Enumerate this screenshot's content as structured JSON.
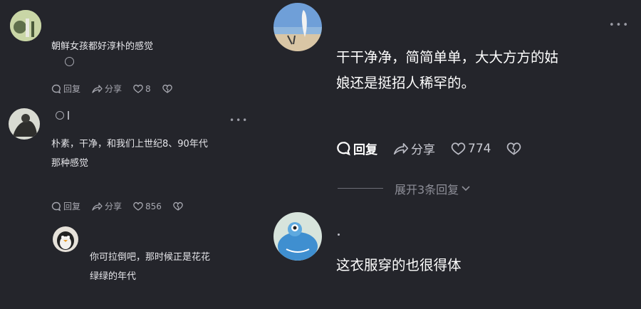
{
  "left": {
    "c1": {
      "text": "朝鲜女孩都好淳朴的感觉",
      "actions": {
        "reply": "回复",
        "share": "分享",
        "likes": "8"
      }
    },
    "c2": {
      "line1": "朴素，干净，和我们上世纪8、90年代",
      "line2": "那种感觉",
      "actions": {
        "reply": "回复",
        "share": "分享",
        "likes": "856"
      }
    },
    "c3": {
      "line1": "你可拉倒吧，那时候正是花花",
      "line2": "绿绿的年代"
    }
  },
  "right": {
    "c1": {
      "line1": "干干净净，简简单单，大大方方的姑",
      "line2": "娘还是挺招人稀罕的。",
      "actions": {
        "reply": "回复",
        "share": "分享",
        "likes": "774"
      },
      "expand": "展开3条回复"
    },
    "c2": {
      "text": "这衣服穿的也很得体"
    }
  }
}
